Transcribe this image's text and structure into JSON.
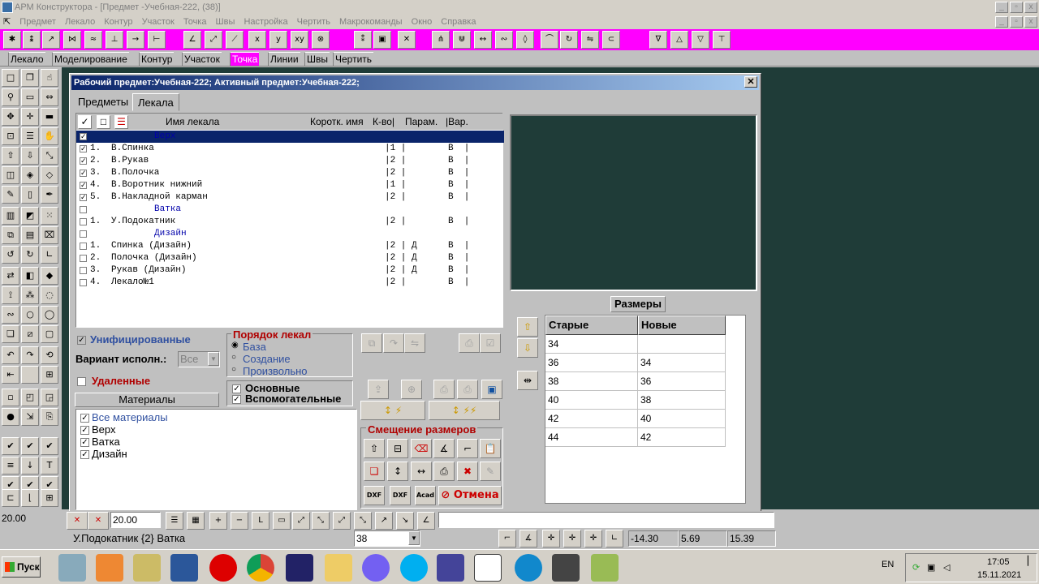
{
  "window": {
    "title": "АРМ Конструктора - [Предмет -Учебная-222, (38)]",
    "controls": [
      "_",
      "▫",
      "x"
    ]
  },
  "menu": [
    "Предмет",
    "Лекало",
    "Контур",
    "Участок",
    "Точка",
    "Швы",
    "Настройка",
    "Чертить",
    "Макрокоманды",
    "Окно",
    "Справка"
  ],
  "mode_tabs": [
    "Лекало",
    "Моделирование",
    "Контур",
    "Участок",
    "Точка",
    "Линии",
    "Швы",
    "Чертить"
  ],
  "mode_active": "Точка",
  "dialog": {
    "title": "Рабочий предмет:Учебная-222;  Активный предмет:Учебная-222;",
    "tabs": [
      "Предметы",
      "Лекала"
    ],
    "columns": {
      "name": "Имя лекала",
      "short": "Коротк. имя",
      "qty": "К-во|",
      "params": "Парам.",
      "var": "|Вар."
    },
    "rows": [
      {
        "checked": true,
        "num": "",
        "name": "",
        "group": "Верх",
        "qty": "",
        "par": "",
        "var": "",
        "selected": true
      },
      {
        "checked": true,
        "num": "1.",
        "name": "В.Спинка",
        "group": "",
        "qty": "|1 |",
        "par": "",
        "var": "В  |"
      },
      {
        "checked": true,
        "num": "2.",
        "name": "В.Рукав",
        "group": "",
        "qty": "|2 |",
        "par": "",
        "var": "В  |"
      },
      {
        "checked": true,
        "num": "3.",
        "name": "В.Полочка",
        "group": "",
        "qty": "|2 |",
        "par": "",
        "var": "В  |"
      },
      {
        "checked": true,
        "num": "4.",
        "name": "В.Воротник нижний",
        "group": "",
        "qty": "|1 |",
        "par": "",
        "var": "В  |"
      },
      {
        "checked": true,
        "num": "5.",
        "name": "В.Накладной карман",
        "group": "",
        "qty": "|2 |",
        "par": "",
        "var": "В  |"
      },
      {
        "checked": false,
        "num": "",
        "name": "",
        "group": "Ватка",
        "qty": "",
        "par": "",
        "var": ""
      },
      {
        "checked": false,
        "num": "1.",
        "name": "У.Подокатник",
        "group": "",
        "qty": "|2 |",
        "par": "",
        "var": "В  |"
      },
      {
        "checked": false,
        "num": "",
        "name": "",
        "group": "Дизайн",
        "qty": "",
        "par": "",
        "var": ""
      },
      {
        "checked": false,
        "num": "1.",
        "name": "Спинка (Дизайн)",
        "group": "",
        "qty": "|2 | Д",
        "par": "",
        "var": "В  |"
      },
      {
        "checked": false,
        "num": "2.",
        "name": "Полочка (Дизайн)",
        "group": "",
        "qty": "|2 | Д",
        "par": "",
        "var": "В  |"
      },
      {
        "checked": false,
        "num": "3.",
        "name": "Рукав (Дизайн)",
        "group": "",
        "qty": "|2 | Д",
        "par": "",
        "var": "В  |"
      },
      {
        "checked": false,
        "num": "4.",
        "name": "Лекало№1",
        "group": "",
        "qty": "|2 |",
        "par": "",
        "var": "В  |"
      }
    ],
    "unified_label": "Унифицированные",
    "variant_label": "Вариант исполн.:",
    "variant_value": "Все",
    "deleted_label": "Удаленные",
    "materials_button": "Материалы",
    "materials": [
      {
        "label": "Все материалы",
        "checked": true
      },
      {
        "label": "Верх",
        "checked": true
      },
      {
        "label": "Ватка",
        "checked": true
      },
      {
        "label": "Дизайн",
        "checked": true
      }
    ],
    "order_title": "Порядок лекал",
    "order_options": [
      "База",
      "Создание",
      "Произвольно"
    ],
    "order_selected": "База",
    "main_label": "Основные",
    "aux_label": "Вспомогательные",
    "offset_title": "Смещение размеров",
    "cancel_label": "Отмена",
    "sizes_title": "Размеры",
    "sizes_headers": [
      "Старые",
      "Новые"
    ],
    "sizes": [
      [
        "34",
        ""
      ],
      [
        "36",
        "34"
      ],
      [
        "38",
        "36"
      ],
      [
        "40",
        "38"
      ],
      [
        "42",
        "40"
      ],
      [
        "44",
        "42"
      ]
    ]
  },
  "status": {
    "left_value": "20.00",
    "field_value": "20.00",
    "piece": "У.Подокатник {2} Ватка",
    "size_select": "38",
    "coord_x": "-14.30",
    "coord_y": "5.69",
    "coord_z": "15.39"
  },
  "taskbar": {
    "start": "Пуск",
    "lang": "EN",
    "time": "17:05",
    "date": "15.11.2021"
  },
  "colors": {
    "toolbar": "#ff00ff",
    "workspace": "#1f3c38",
    "title": "#0a246a"
  }
}
